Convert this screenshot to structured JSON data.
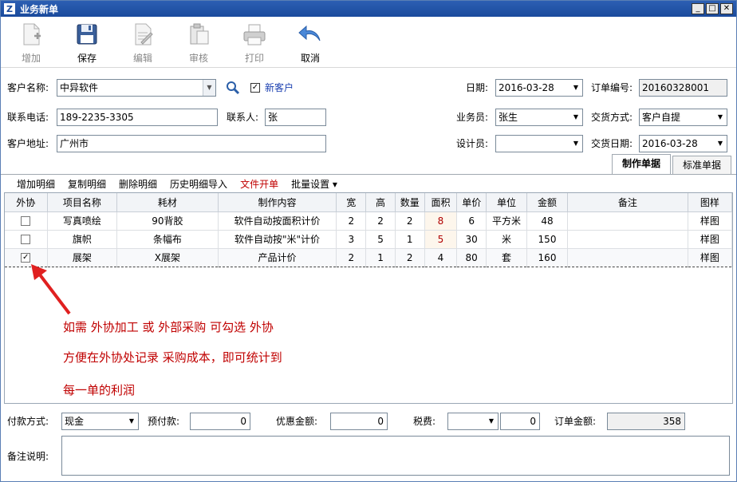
{
  "window": {
    "title": "业务新单",
    "logo_letter": "Z"
  },
  "toolbar": {
    "add": "增加",
    "save": "保存",
    "edit": "编辑",
    "review": "审核",
    "print": "打印",
    "cancel": "取消"
  },
  "form": {
    "customer_name_label": "客户名称:",
    "customer_name": "中异软件",
    "new_customer_label": "新客户",
    "phone_label": "联系电话:",
    "phone": "189-2235-3305",
    "contact_label": "联系人:",
    "contact": "张",
    "address_label": "客户地址:",
    "address": "广州市",
    "date_label": "日期:",
    "date": "2016-03-28",
    "order_no_label": "订单编号:",
    "order_no": "20160328001",
    "salesperson_label": "业务员:",
    "salesperson": "张生",
    "delivery_method_label": "交货方式:",
    "delivery_method": "客户自提",
    "designer_label": "设计员:",
    "designer": "",
    "delivery_date_label": "交货日期:",
    "delivery_date": "2016-03-28"
  },
  "tabs": [
    "制作单据",
    "标准单据"
  ],
  "subtoolbar": [
    "增加明细",
    "复制明细",
    "删除明细",
    "历史明细导入",
    "文件开单",
    "批量设置 ▾"
  ],
  "grid": {
    "columns": [
      "外协",
      "项目名称",
      "耗材",
      "制作内容",
      "宽",
      "高",
      "数量",
      "面积",
      "单价",
      "单位",
      "金额",
      "备注",
      "图样"
    ],
    "rows": [
      {
        "outsource": false,
        "name": "写真喷绘",
        "material": "90背胶",
        "content": "软件自动按面积计价",
        "w": "2",
        "h": "2",
        "qty": "2",
        "area": "8",
        "price": "6",
        "unit": "平方米",
        "amount": "48",
        "note": "",
        "pattern": "样图"
      },
      {
        "outsource": false,
        "name": "旗帜",
        "material": "条幅布",
        "content": "软件自动按\"米\"计价",
        "w": "3",
        "h": "5",
        "qty": "1",
        "area": "5",
        "price": "30",
        "unit": "米",
        "amount": "150",
        "note": "",
        "pattern": "样图"
      },
      {
        "outsource": true,
        "name": "展架",
        "material": "X展架",
        "content": "产品计价",
        "w": "2",
        "h": "1",
        "qty": "2",
        "area": "4",
        "price": "80",
        "unit": "套",
        "amount": "160",
        "note": "",
        "pattern": "样图"
      }
    ]
  },
  "annotation": {
    "line1": "如需 外协加工 或 外部采购 可勾选 外协",
    "line2": "方便在外协处记录 采购成本，即可统计到",
    "line3": "每一单的利润"
  },
  "footer": {
    "payment_method_label": "付款方式:",
    "payment_method": "现金",
    "prepaid_label": "预付款:",
    "prepaid": "0",
    "discount_label": "优惠金额:",
    "discount": "0",
    "tax_label": "税费:",
    "tax_type": "",
    "tax": "0",
    "order_amount_label": "订单金额:",
    "order_amount": "358",
    "remark_label": "备注说明:",
    "remark": ""
  },
  "colors": {
    "title_bar": "#1a4a9c",
    "accent_red": "#c00000",
    "link_blue": "#1a3fb0"
  },
  "icons": {
    "search": "search-icon",
    "undo": "undo-arrow-icon"
  }
}
